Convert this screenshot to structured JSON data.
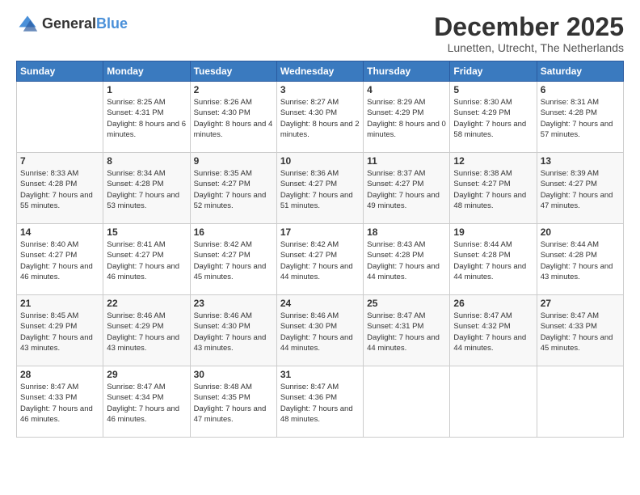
{
  "logo": {
    "general": "General",
    "blue": "Blue"
  },
  "title": "December 2025",
  "location": "Lunetten, Utrecht, The Netherlands",
  "days_header": [
    "Sunday",
    "Monday",
    "Tuesday",
    "Wednesday",
    "Thursday",
    "Friday",
    "Saturday"
  ],
  "weeks": [
    [
      {
        "day": "",
        "sunrise": "",
        "sunset": "",
        "daylight": ""
      },
      {
        "day": "1",
        "sunrise": "Sunrise: 8:25 AM",
        "sunset": "Sunset: 4:31 PM",
        "daylight": "Daylight: 8 hours and 6 minutes."
      },
      {
        "day": "2",
        "sunrise": "Sunrise: 8:26 AM",
        "sunset": "Sunset: 4:30 PM",
        "daylight": "Daylight: 8 hours and 4 minutes."
      },
      {
        "day": "3",
        "sunrise": "Sunrise: 8:27 AM",
        "sunset": "Sunset: 4:30 PM",
        "daylight": "Daylight: 8 hours and 2 minutes."
      },
      {
        "day": "4",
        "sunrise": "Sunrise: 8:29 AM",
        "sunset": "Sunset: 4:29 PM",
        "daylight": "Daylight: 8 hours and 0 minutes."
      },
      {
        "day": "5",
        "sunrise": "Sunrise: 8:30 AM",
        "sunset": "Sunset: 4:29 PM",
        "daylight": "Daylight: 7 hours and 58 minutes."
      },
      {
        "day": "6",
        "sunrise": "Sunrise: 8:31 AM",
        "sunset": "Sunset: 4:28 PM",
        "daylight": "Daylight: 7 hours and 57 minutes."
      }
    ],
    [
      {
        "day": "7",
        "sunrise": "Sunrise: 8:33 AM",
        "sunset": "Sunset: 4:28 PM",
        "daylight": "Daylight: 7 hours and 55 minutes."
      },
      {
        "day": "8",
        "sunrise": "Sunrise: 8:34 AM",
        "sunset": "Sunset: 4:28 PM",
        "daylight": "Daylight: 7 hours and 53 minutes."
      },
      {
        "day": "9",
        "sunrise": "Sunrise: 8:35 AM",
        "sunset": "Sunset: 4:27 PM",
        "daylight": "Daylight: 7 hours and 52 minutes."
      },
      {
        "day": "10",
        "sunrise": "Sunrise: 8:36 AM",
        "sunset": "Sunset: 4:27 PM",
        "daylight": "Daylight: 7 hours and 51 minutes."
      },
      {
        "day": "11",
        "sunrise": "Sunrise: 8:37 AM",
        "sunset": "Sunset: 4:27 PM",
        "daylight": "Daylight: 7 hours and 49 minutes."
      },
      {
        "day": "12",
        "sunrise": "Sunrise: 8:38 AM",
        "sunset": "Sunset: 4:27 PM",
        "daylight": "Daylight: 7 hours and 48 minutes."
      },
      {
        "day": "13",
        "sunrise": "Sunrise: 8:39 AM",
        "sunset": "Sunset: 4:27 PM",
        "daylight": "Daylight: 7 hours and 47 minutes."
      }
    ],
    [
      {
        "day": "14",
        "sunrise": "Sunrise: 8:40 AM",
        "sunset": "Sunset: 4:27 PM",
        "daylight": "Daylight: 7 hours and 46 minutes."
      },
      {
        "day": "15",
        "sunrise": "Sunrise: 8:41 AM",
        "sunset": "Sunset: 4:27 PM",
        "daylight": "Daylight: 7 hours and 46 minutes."
      },
      {
        "day": "16",
        "sunrise": "Sunrise: 8:42 AM",
        "sunset": "Sunset: 4:27 PM",
        "daylight": "Daylight: 7 hours and 45 minutes."
      },
      {
        "day": "17",
        "sunrise": "Sunrise: 8:42 AM",
        "sunset": "Sunset: 4:27 PM",
        "daylight": "Daylight: 7 hours and 44 minutes."
      },
      {
        "day": "18",
        "sunrise": "Sunrise: 8:43 AM",
        "sunset": "Sunset: 4:28 PM",
        "daylight": "Daylight: 7 hours and 44 minutes."
      },
      {
        "day": "19",
        "sunrise": "Sunrise: 8:44 AM",
        "sunset": "Sunset: 4:28 PM",
        "daylight": "Daylight: 7 hours and 44 minutes."
      },
      {
        "day": "20",
        "sunrise": "Sunrise: 8:44 AM",
        "sunset": "Sunset: 4:28 PM",
        "daylight": "Daylight: 7 hours and 43 minutes."
      }
    ],
    [
      {
        "day": "21",
        "sunrise": "Sunrise: 8:45 AM",
        "sunset": "Sunset: 4:29 PM",
        "daylight": "Daylight: 7 hours and 43 minutes."
      },
      {
        "day": "22",
        "sunrise": "Sunrise: 8:46 AM",
        "sunset": "Sunset: 4:29 PM",
        "daylight": "Daylight: 7 hours and 43 minutes."
      },
      {
        "day": "23",
        "sunrise": "Sunrise: 8:46 AM",
        "sunset": "Sunset: 4:30 PM",
        "daylight": "Daylight: 7 hours and 43 minutes."
      },
      {
        "day": "24",
        "sunrise": "Sunrise: 8:46 AM",
        "sunset": "Sunset: 4:30 PM",
        "daylight": "Daylight: 7 hours and 44 minutes."
      },
      {
        "day": "25",
        "sunrise": "Sunrise: 8:47 AM",
        "sunset": "Sunset: 4:31 PM",
        "daylight": "Daylight: 7 hours and 44 minutes."
      },
      {
        "day": "26",
        "sunrise": "Sunrise: 8:47 AM",
        "sunset": "Sunset: 4:32 PM",
        "daylight": "Daylight: 7 hours and 44 minutes."
      },
      {
        "day": "27",
        "sunrise": "Sunrise: 8:47 AM",
        "sunset": "Sunset: 4:33 PM",
        "daylight": "Daylight: 7 hours and 45 minutes."
      }
    ],
    [
      {
        "day": "28",
        "sunrise": "Sunrise: 8:47 AM",
        "sunset": "Sunset: 4:33 PM",
        "daylight": "Daylight: 7 hours and 46 minutes."
      },
      {
        "day": "29",
        "sunrise": "Sunrise: 8:47 AM",
        "sunset": "Sunset: 4:34 PM",
        "daylight": "Daylight: 7 hours and 46 minutes."
      },
      {
        "day": "30",
        "sunrise": "Sunrise: 8:48 AM",
        "sunset": "Sunset: 4:35 PM",
        "daylight": "Daylight: 7 hours and 47 minutes."
      },
      {
        "day": "31",
        "sunrise": "Sunrise: 8:47 AM",
        "sunset": "Sunset: 4:36 PM",
        "daylight": "Daylight: 7 hours and 48 minutes."
      },
      {
        "day": "",
        "sunrise": "",
        "sunset": "",
        "daylight": ""
      },
      {
        "day": "",
        "sunrise": "",
        "sunset": "",
        "daylight": ""
      },
      {
        "day": "",
        "sunrise": "",
        "sunset": "",
        "daylight": ""
      }
    ]
  ]
}
